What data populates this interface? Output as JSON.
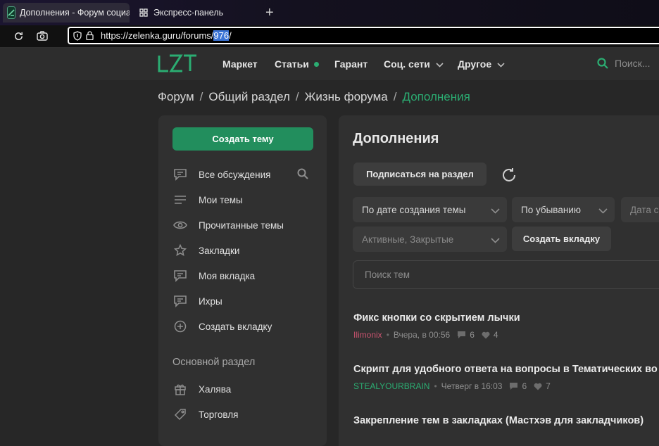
{
  "browser": {
    "tabs": [
      {
        "title": "Дополнения - Форум социальной инженерии",
        "icon": "zelenka-favicon-icon",
        "active": true
      },
      {
        "title": "Экспресс-панель",
        "icon": "grid-icon",
        "active": false
      }
    ],
    "new_tab_label": "+",
    "url_prefix": "https://zelenka.guru/forums/",
    "url_selected": "976",
    "url_suffix": "/"
  },
  "header": {
    "logo": "LZT",
    "nav": [
      {
        "label": "Маркет",
        "has_dot": false,
        "has_dropdown": false
      },
      {
        "label": "Статьи",
        "has_dot": true,
        "has_dropdown": false
      },
      {
        "label": "Гарант",
        "has_dot": false,
        "has_dropdown": false
      },
      {
        "label": "Соц. сети",
        "has_dot": false,
        "has_dropdown": true
      },
      {
        "label": "Другое",
        "has_dot": false,
        "has_dropdown": true
      }
    ],
    "search_placeholder": "Поиск..."
  },
  "breadcrumb": {
    "items": [
      "Форум",
      "Общий раздел",
      "Жизнь форума"
    ],
    "current": "Дополнения",
    "separator": "/"
  },
  "sidebar": {
    "create_button": "Создать тему",
    "items": [
      {
        "label": "Все обсуждения",
        "icon": "chat-icon"
      },
      {
        "label": "Мои темы",
        "icon": "lines-icon"
      },
      {
        "label": "Прочитанные темы",
        "icon": "eye-icon"
      },
      {
        "label": "Закладки",
        "icon": "star-icon"
      },
      {
        "label": "Моя вкладка",
        "icon": "chat-icon"
      },
      {
        "label": "Ихры",
        "icon": "chat-icon"
      },
      {
        "label": "Создать вкладку",
        "icon": "plus-circle-icon"
      }
    ],
    "section_title": "Основной раздел",
    "section_items": [
      {
        "label": "Халява",
        "icon": "gift-icon"
      },
      {
        "label": "Торговля",
        "icon": "tag-icon"
      }
    ]
  },
  "main": {
    "title": "Дополнения",
    "subscribe_button": "Подписаться на раздел",
    "filters": {
      "sort_by": "По дате создания темы",
      "order": "По убыванию",
      "date": "Дата с",
      "state": "Активные, Закрытые",
      "create_tab_button": "Создать вкладку"
    },
    "search_placeholder": "Поиск тем",
    "threads": [
      {
        "title": "Фикс кнопки со скрытием лычки",
        "author": "Ilimonix",
        "author_color": "#c9536f",
        "time": "Вчера, в 00:56",
        "replies": "6",
        "likes": "4"
      },
      {
        "title": "Скрипт для удобного ответа на вопросы в Тематических во",
        "author": "STEALYOURBRAIN",
        "author_color": "#2bad72",
        "time": "Четверг в 16:03",
        "replies": "6",
        "likes": "7"
      },
      {
        "title": "Закрепление тем в закладках (Мастхэв для закладчиков)",
        "author": "",
        "author_color": "",
        "time": "",
        "replies": "",
        "likes": ""
      }
    ]
  },
  "colors": {
    "accent": "#2bad72",
    "button_green": "#228e5d",
    "background": "#272727",
    "panel": "#303030"
  }
}
